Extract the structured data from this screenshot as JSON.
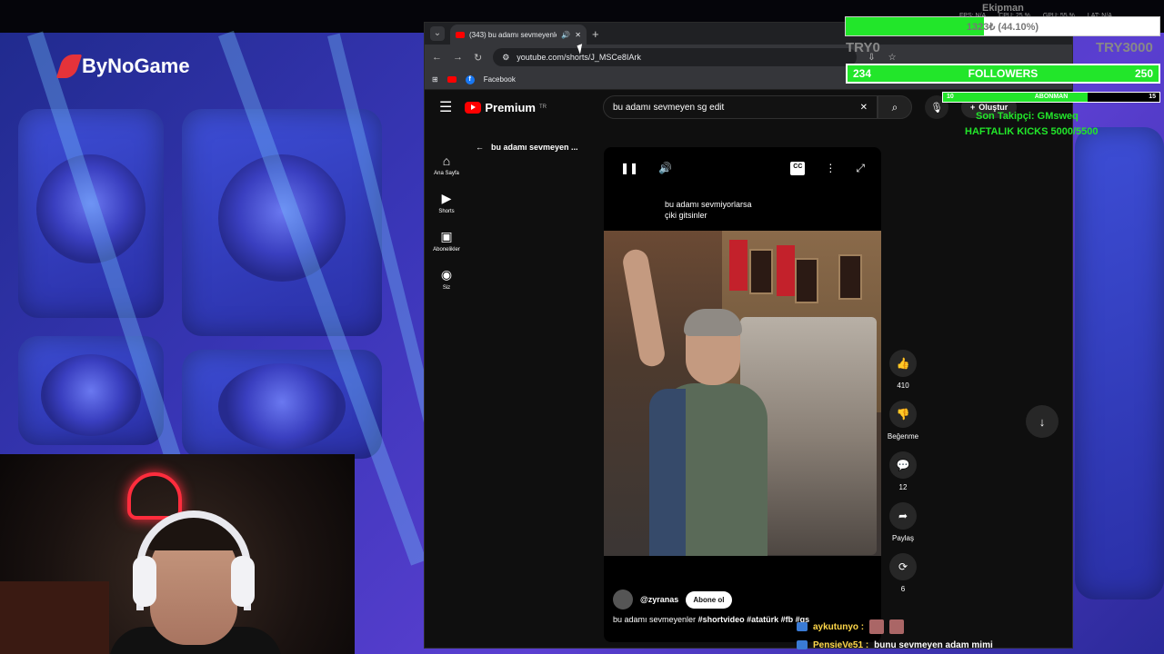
{
  "stream": {
    "brand": "ByNoGame",
    "overlay": {
      "team_label": "Ekipman",
      "progress_text": "1323₺ (44.10%)",
      "progress_fraction": 0.441,
      "stats": [
        "FPS: N/A",
        "CPU: 25 %",
        "GPU: 55 %",
        "LAT: N/A"
      ],
      "goal_min": "TRY0",
      "goal_max": "TRY3000",
      "followers_current": "234",
      "followers_label": "FOLLOWERS",
      "followers_target": "250",
      "abonman_current": "10",
      "abonman_label": "ABONMAN",
      "abonman_target": "15",
      "abonman_fraction": 0.667,
      "last_follower": "Son Takipçi: GMsweq",
      "weekly_kicks": "HAFTALIK KICKS 5000/5500"
    },
    "chat": [
      {
        "user": "aykutunyo :",
        "message": ""
      },
      {
        "user": "PensieVe51 :",
        "message": "bunu sevmeyen adam mimi"
      }
    ]
  },
  "browser": {
    "tab_title": "(343) bu adamı sevmeyenler",
    "url": "youtube.com/shorts/J_MSCe8IArk",
    "bookmarks": [
      "Facebook"
    ]
  },
  "youtube": {
    "logo_text": "Premium",
    "logo_region": "TR",
    "search_value": "bu adamı sevmeyen sg edit",
    "create_label": "Oluştur",
    "notifications": "9+",
    "sidebar": [
      {
        "icon": "home-icon",
        "glyph": "⌂",
        "label": "Ana Sayfa"
      },
      {
        "icon": "shorts-icon",
        "glyph": "▶",
        "label": "Shorts"
      },
      {
        "icon": "subscriptions-icon",
        "glyph": "▣",
        "label": "Abonelikler"
      },
      {
        "icon": "you-icon",
        "glyph": "◉",
        "label": "Siz"
      }
    ],
    "back_title": "bu adamı sevmeyen ...",
    "short": {
      "caption_line1": "bu adamı sevmiyorlarsa",
      "caption_line2": "çiki gitsinler",
      "channel": "@zyranas",
      "subscribe_label": "Abone ol",
      "description": "bu adamı sevmeyenler",
      "hashtags": "#shortvideo #atatürk #fb #gs"
    },
    "actions": [
      {
        "icon": "like-icon",
        "glyph": "👍",
        "label": "410"
      },
      {
        "icon": "dislike-icon",
        "glyph": "👎",
        "label": "Beğenme"
      },
      {
        "icon": "comment-icon",
        "glyph": "💬",
        "label": "12"
      },
      {
        "icon": "share-icon",
        "glyph": "➦",
        "label": "Paylaş"
      },
      {
        "icon": "remix-icon",
        "glyph": "⟳",
        "label": "6"
      }
    ]
  }
}
